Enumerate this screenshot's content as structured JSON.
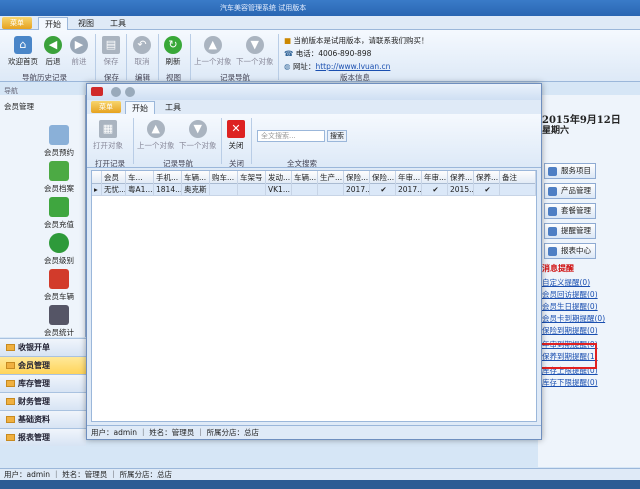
{
  "app": {
    "title": "汽车美容管理系统 试用版本"
  },
  "main_tabs": {
    "file": "菜单",
    "start": "开始",
    "view": "视图",
    "tools": "工具"
  },
  "ribbon": {
    "home": "欢迎首页",
    "back": "后退",
    "forward": "前进",
    "save": "保存",
    "cancel": "取消",
    "refresh": "刷新",
    "prev": "上一个对象",
    "next": "下一个对象",
    "groups": {
      "nav_history": "导航历史记录",
      "save": "保存",
      "edit": "编辑",
      "view": "视图",
      "record_nav": "记录导航",
      "version_info": "版本信息"
    },
    "notice": "当前版本是试用版本，请联系我们购买！",
    "phone_label": "电话：",
    "phone": "4006-890-898",
    "web_label": "网址：",
    "web": "http://www.lvuan.cn"
  },
  "nav": {
    "header": "导航",
    "section_title": "会员管理",
    "items": [
      {
        "label": "会员预约"
      },
      {
        "label": "会员档案"
      },
      {
        "label": "会员充值"
      },
      {
        "label": "会员级别"
      },
      {
        "label": "会员车辆"
      },
      {
        "label": "会员统计"
      }
    ],
    "modules": [
      "收银开单",
      "会员管理",
      "库存管理",
      "财务管理",
      "基础资料",
      "报表管理"
    ]
  },
  "right": {
    "date": "2015年9月12日",
    "weekday": "星期六",
    "buttons": [
      "服务项目",
      "产品管理",
      "套餐管理",
      "提醒管理",
      "报表中心"
    ],
    "reminder_title": "消息提醒",
    "reminders": [
      "自定义提醒(0)",
      "会员回访提醒(0)",
      "会员生日提醒(0)",
      "会员卡到期提醒(0)",
      "保险到期提醒(0)",
      "年审到期提醒(0)",
      "保养到期提醒(1)",
      "库存上限提醒(0)",
      "库存下限提醒(0)"
    ]
  },
  "status": {
    "user": "用户：admin",
    "name": "姓名：管理员",
    "store": "所属分店：总店"
  },
  "dialog": {
    "tabs": {
      "file": "菜单",
      "start": "开始",
      "tools": "工具"
    },
    "buttons": {
      "open": "打开对象",
      "prev": "上一个对象",
      "next": "下一个对象",
      "close": "关闭"
    },
    "groups": {
      "open": "打开记录",
      "nav": "记录导航",
      "close": "关闭",
      "search": "全文搜索"
    },
    "search_placeholder": "全文搜索...",
    "search_btn": "搜索",
    "columns": [
      "会员",
      "车...",
      "手机...",
      "车辆...",
      "购车...",
      "车架号",
      "发动...",
      "车辆...",
      "生产...",
      "保险...",
      "保险...",
      "年审...",
      "年审...",
      "保养...",
      "保养...",
      "备注"
    ],
    "row": [
      "无忧...",
      "粤A1...",
      "1814...",
      "奥克斯",
      "",
      "",
      "VK1...",
      "",
      "",
      "2017...",
      "✔",
      "2017...",
      "✔",
      "2015...",
      "✔",
      ""
    ],
    "status": {
      "user": "用户：admin",
      "name": "姓名：管理员",
      "store": "所属分店：总店"
    }
  }
}
